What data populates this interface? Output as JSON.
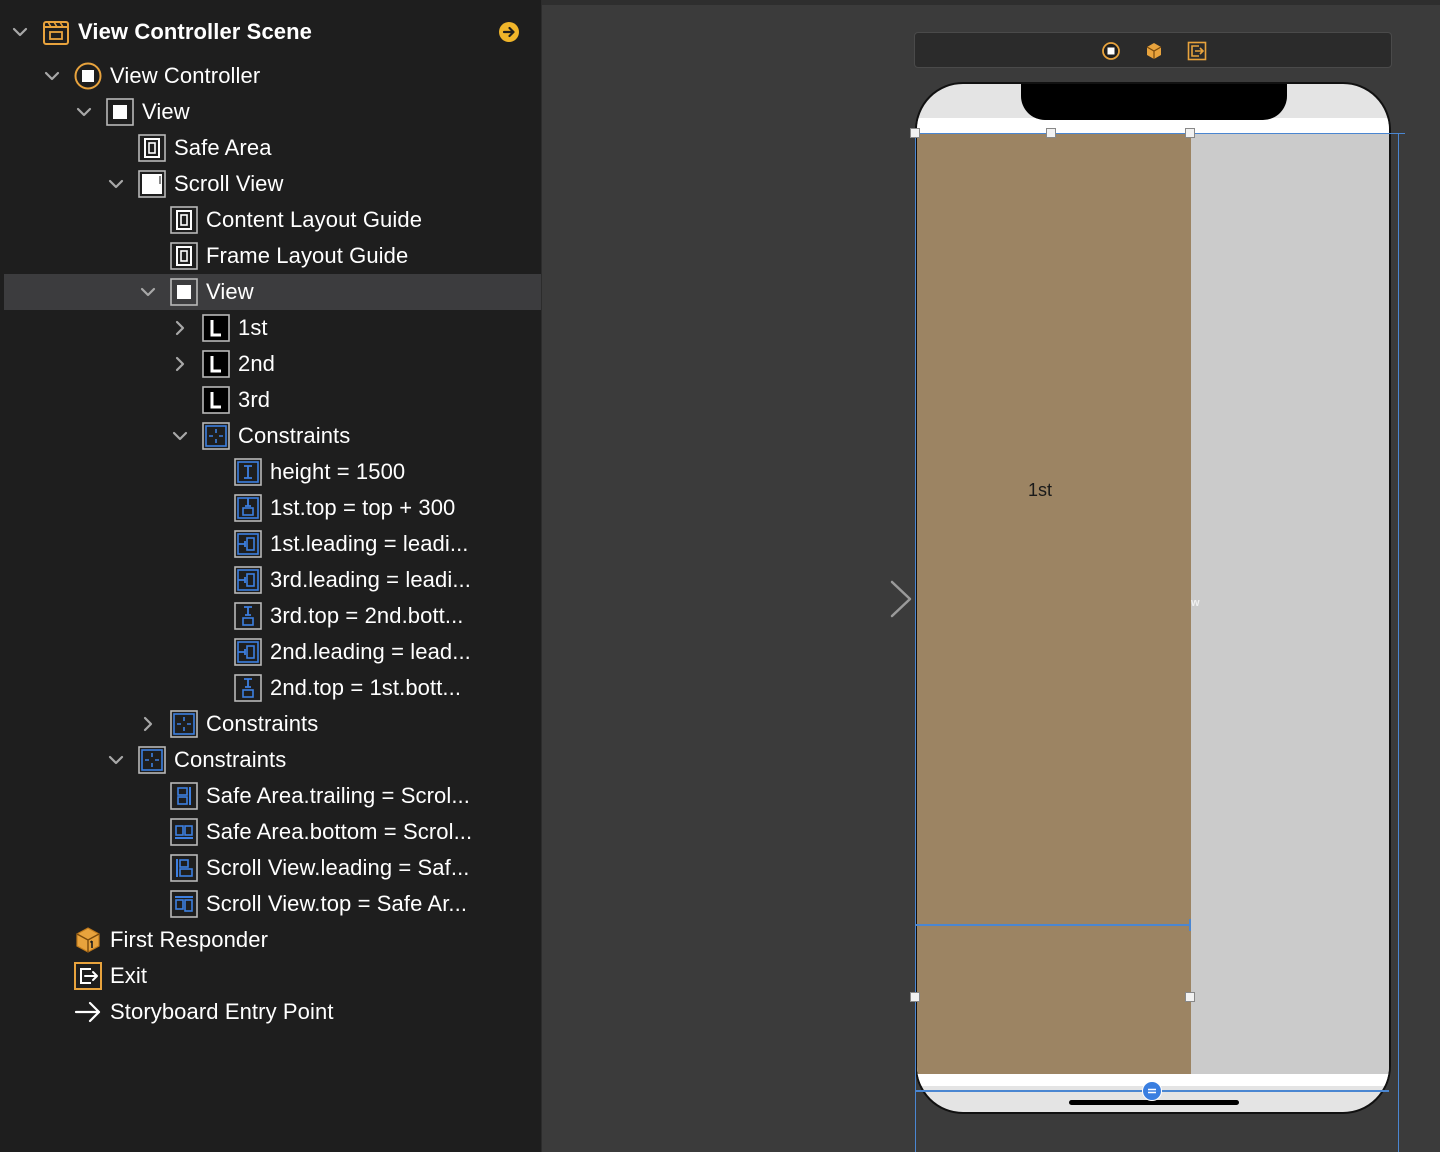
{
  "outline": {
    "scene_title": "View Controller Scene",
    "items": [
      {
        "label": "View Controller",
        "icon": "view-controller-icon",
        "expanded": true
      },
      {
        "label": "View",
        "icon": "view-icon",
        "expanded": true
      },
      {
        "label": "Safe Area",
        "icon": "layout-guide-icon"
      },
      {
        "label": "Scroll View",
        "icon": "scroll-view-icon",
        "expanded": true
      },
      {
        "label": "Content Layout Guide",
        "icon": "layout-guide-icon"
      },
      {
        "label": "Frame Layout Guide",
        "icon": "layout-guide-icon"
      },
      {
        "label": "View",
        "icon": "view-icon",
        "expanded": true,
        "selected": true
      },
      {
        "label": "1st",
        "icon": "label-icon",
        "expanded": false
      },
      {
        "label": "2nd",
        "icon": "label-icon",
        "expanded": false
      },
      {
        "label": "3rd",
        "icon": "label-icon"
      },
      {
        "label": "Constraints",
        "icon": "constraints-icon",
        "expanded": true
      },
      {
        "label": "height = 1500",
        "icon": "height-constraint-icon"
      },
      {
        "label": "1st.top = top + 300",
        "icon": "top-constraint-icon"
      },
      {
        "label": "1st.leading = leadi...",
        "icon": "leading-constraint-icon"
      },
      {
        "label": "3rd.leading = leadi...",
        "icon": "leading-constraint-icon"
      },
      {
        "label": "3rd.top = 2nd.bott...",
        "icon": "vertical-spacing-icon"
      },
      {
        "label": "2nd.leading = lead...",
        "icon": "leading-constraint-icon"
      },
      {
        "label": "2nd.top = 1st.bott...",
        "icon": "vertical-spacing-icon"
      },
      {
        "label": "Constraints",
        "icon": "constraints-icon",
        "expanded": false
      },
      {
        "label": "Constraints",
        "icon": "constraints-icon",
        "expanded": true
      },
      {
        "label": "Safe Area.trailing = Scrol...",
        "icon": "trailing-constraint-icon"
      },
      {
        "label": "Safe Area.bottom = Scrol...",
        "icon": "bottom-constraint-icon"
      },
      {
        "label": "Scroll View.leading = Saf...",
        "icon": "leading-align-icon"
      },
      {
        "label": "Scroll View.top = Safe Ar...",
        "icon": "top-align-icon"
      },
      {
        "label": "First Responder",
        "icon": "first-responder-icon"
      },
      {
        "label": "Exit",
        "icon": "exit-icon"
      },
      {
        "label": "Storyboard Entry Point",
        "icon": "arrow-right-icon"
      }
    ]
  },
  "canvas": {
    "content_label": "1st",
    "width_hint": "w",
    "dock_icons": [
      "view-controller-icon",
      "first-responder-icon",
      "exit-icon"
    ]
  },
  "colors": {
    "selection": "#3c3c3e",
    "accent_blue": "#4a86d1",
    "icon_orange": "#e8a33d",
    "content_view": "#9c8463",
    "scroll_view": "#cbcbcb"
  }
}
